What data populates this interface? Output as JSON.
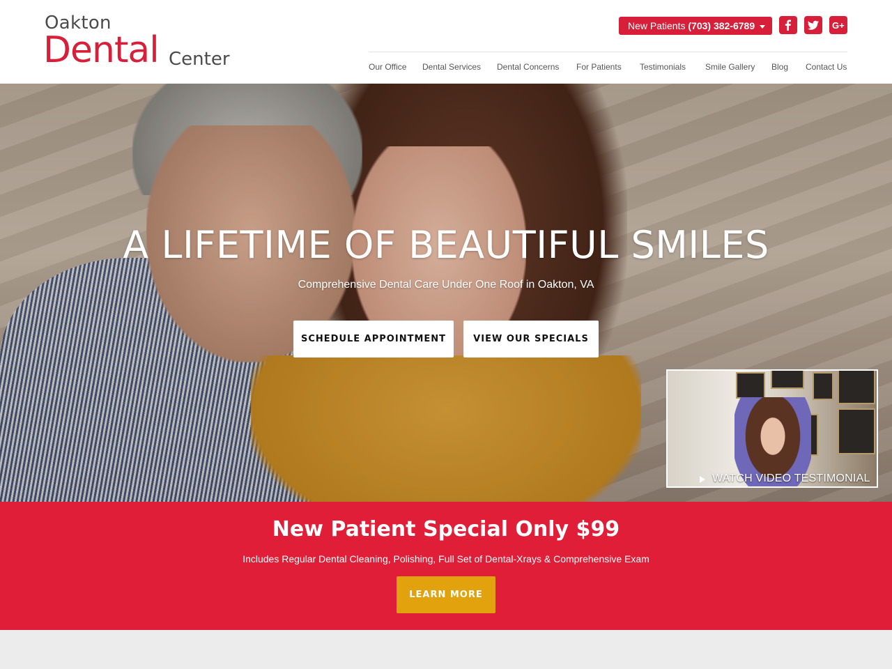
{
  "logo": {
    "line1": "Oakton",
    "line2": "Dental",
    "line3": "Center"
  },
  "header": {
    "new_patients_label": "New Patients",
    "new_patients_phone": "(703) 382-6789",
    "social": [
      "facebook-icon",
      "twitter-icon",
      "google-plus-icon"
    ]
  },
  "nav": {
    "items": [
      {
        "label": "Our Office"
      },
      {
        "label": "Dental Services"
      },
      {
        "label": "Dental Concerns"
      },
      {
        "label": "For Patients"
      },
      {
        "label": "Testimonials"
      },
      {
        "label": "Smile Gallery"
      },
      {
        "label": "Blog"
      },
      {
        "label": "Contact Us"
      }
    ]
  },
  "hero": {
    "title": "A LIFETIME OF BEAUTIFUL SMILES",
    "subtitle": "Comprehensive Dental Care Under One Roof in Oakton, VA",
    "buttons": [
      "SCHEDULE APPOINTMENT",
      "VIEW OUR SPECIALS"
    ],
    "video_label": "WATCH VIDEO TESTIMONIAL"
  },
  "special": {
    "title": "New Patient Special Only $99",
    "description": "Includes Regular Dental Cleaning, Polishing, Full Set of Dental-Xrays & Comprehensive Exam",
    "button": "LEARN MORE"
  },
  "colors": {
    "brand_red": "#d81f3a",
    "special_bg": "#e01e37",
    "cta_gold": "#e2a20e"
  }
}
